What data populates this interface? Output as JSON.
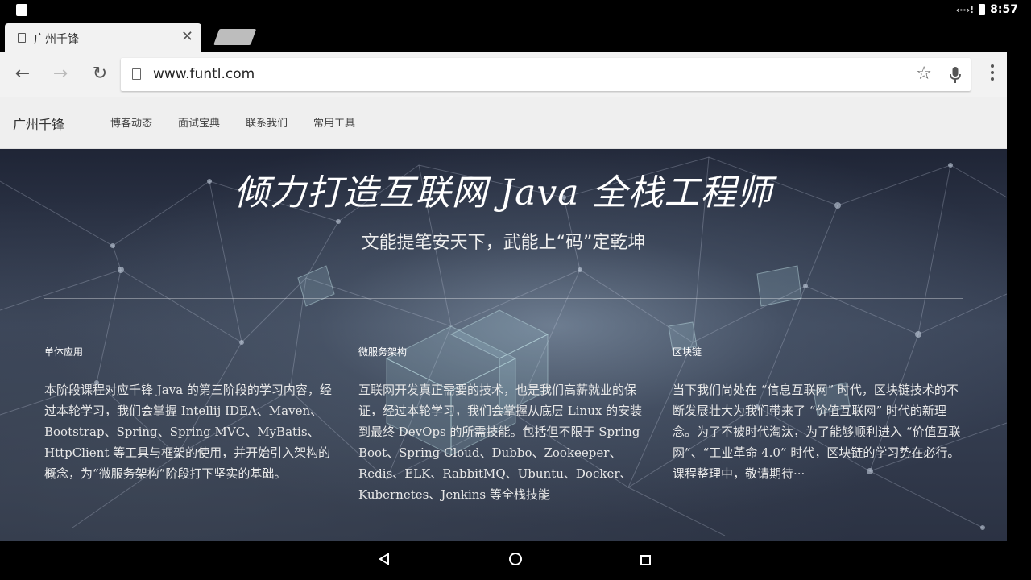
{
  "status_bar": {
    "time": "8:57",
    "signal_glyph": "‹··›!"
  },
  "browser": {
    "tab": {
      "title": "广州千锋"
    },
    "omnibox": {
      "url": "www.funtl.com"
    }
  },
  "site": {
    "brand": "广州千锋",
    "nav": [
      "博客动态",
      "面试宝典",
      "联系我们",
      "常用工具"
    ],
    "hero": {
      "headline": "倾力打造互联网 Java 全栈工程师",
      "subline": "文能提笔安天下，武能上“码”定乾坤"
    },
    "columns": [
      {
        "title": "单体应用",
        "body": "本阶段课程对应千锋 Java 的第三阶段的学习内容，经过本轮学习，我们会掌握 Intellij IDEA、Maven、Bootstrap、Spring、Spring MVC、MyBatis、HttpClient 等工具与框架的使用，并开始引入架构的概念，为“微服务架构”阶段打下坚实的基础。"
      },
      {
        "title": "微服务架构",
        "body": "互联网开发真正需要的技术，也是我们高薪就业的保证，经过本轮学习，我们会掌握从底层 Linux 的安装到最终 DevOps 的所需技能。包括但不限于 Spring Boot、Spring Cloud、Dubbo、Zookeeper、Redis、ELK、RabbitMQ、Ubuntu、Docker、Kubernetes、Jenkins 等全栈技能"
      },
      {
        "title": "区块链",
        "body": "当下我们尚处在 “信息互联网” 时代，区块链技术的不断发展壮大为我们带来了 “价值互联网” 时代的新理念。为了不被时代淘汰，为了能够顺利进入 “价值互联网”、“工业革命 4.0” 时代，区块链的学习势在必行。课程整理中，敬请期待···"
      }
    ]
  },
  "icons": {
    "back": "arrow-left-icon",
    "forward": "arrow-right-icon",
    "reload": "reload-icon",
    "star": "star-icon",
    "mic": "mic-icon",
    "menu": "kebab-menu-icon"
  }
}
